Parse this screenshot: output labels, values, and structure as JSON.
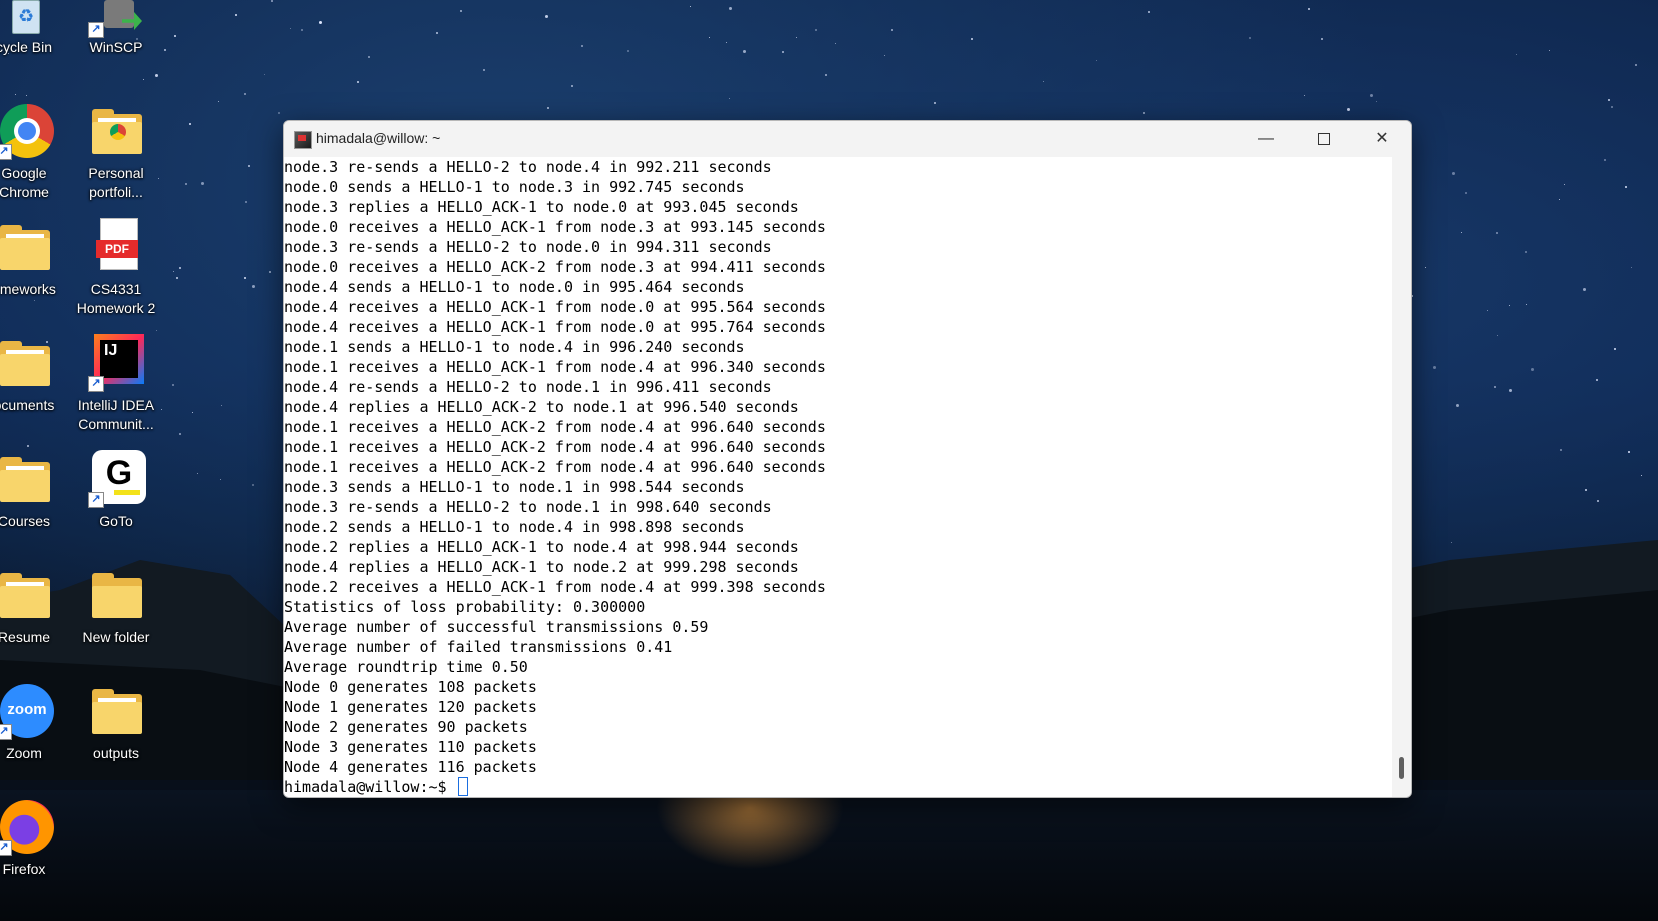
{
  "desktop": {
    "icons": [
      {
        "label": "cycle Bin"
      },
      {
        "label": "WinSCP"
      },
      {
        "label": "Google\nChrome"
      },
      {
        "label": "Personal\nportfoli..."
      },
      {
        "label": "omeworks"
      },
      {
        "label": "CS4331\nHomework 2"
      },
      {
        "label": "ocuments"
      },
      {
        "label": "IntelliJ IDEA\nCommunit..."
      },
      {
        "label": "Courses"
      },
      {
        "label": "GoTo"
      },
      {
        "label": "Resume"
      },
      {
        "label": "New folder"
      },
      {
        "label": "Zoom"
      },
      {
        "label": "outputs"
      },
      {
        "label": "Firefox"
      }
    ],
    "icon_text": {
      "pdf": "PDF",
      "ij": "IJ",
      "goto": "G",
      "zoom": "zoom"
    }
  },
  "window": {
    "title": "himadala@willow: ~",
    "controls": {
      "minimize": "—",
      "close": "✕"
    }
  },
  "terminal": {
    "lines": [
      "node.3 re-sends a HELLO-2 to node.4 in 992.211 seconds",
      "node.0 sends a HELLO-1 to node.3 in 992.745 seconds",
      "node.3 replies a HELLO_ACK-1 to node.0 at 993.045 seconds",
      "node.0 receives a HELLO_ACK-1 from node.3 at 993.145 seconds",
      "node.3 re-sends a HELLO-2 to node.0 in 994.311 seconds",
      "node.0 receives a HELLO_ACK-2 from node.3 at 994.411 seconds",
      "node.4 sends a HELLO-1 to node.0 in 995.464 seconds",
      "node.4 receives a HELLO_ACK-1 from node.0 at 995.564 seconds",
      "node.4 receives a HELLO_ACK-1 from node.0 at 995.764 seconds",
      "node.1 sends a HELLO-1 to node.4 in 996.240 seconds",
      "node.1 receives a HELLO_ACK-1 from node.4 at 996.340 seconds",
      "node.4 re-sends a HELLO-2 to node.1 in 996.411 seconds",
      "node.4 replies a HELLO_ACK-2 to node.1 at 996.540 seconds",
      "node.1 receives a HELLO_ACK-2 from node.4 at 996.640 seconds",
      "node.1 receives a HELLO_ACK-2 from node.4 at 996.640 seconds",
      "node.1 receives a HELLO_ACK-2 from node.4 at 996.640 seconds",
      "node.3 sends a HELLO-1 to node.1 in 998.544 seconds",
      "node.3 re-sends a HELLO-2 to node.1 in 998.640 seconds",
      "node.2 sends a HELLO-1 to node.4 in 998.898 seconds",
      "node.2 replies a HELLO_ACK-1 to node.4 at 998.944 seconds",
      "node.4 replies a HELLO_ACK-1 to node.2 at 999.298 seconds",
      "node.2 receives a HELLO_ACK-1 from node.4 at 999.398 seconds",
      "Statistics of loss probability: 0.300000",
      "Average number of successful transmissions 0.59",
      "Average number of failed transmissions 0.41",
      "Average roundtrip time 0.50",
      "Node 0 generates 108 packets",
      "Node 1 generates 120 packets",
      "Node 2 generates 90 packets",
      "Node 3 generates 110 packets",
      "Node 4 generates 116 packets"
    ],
    "prompt": "himadala@willow:~$ "
  }
}
